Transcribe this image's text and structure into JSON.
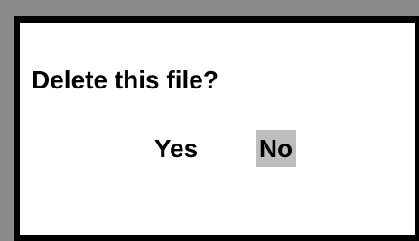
{
  "dialog": {
    "question": "Delete this file?",
    "options": [
      {
        "label": "Yes",
        "selected": false
      },
      {
        "label": "No",
        "selected": true
      }
    ],
    "highlight_color": "#bdbdbd"
  }
}
